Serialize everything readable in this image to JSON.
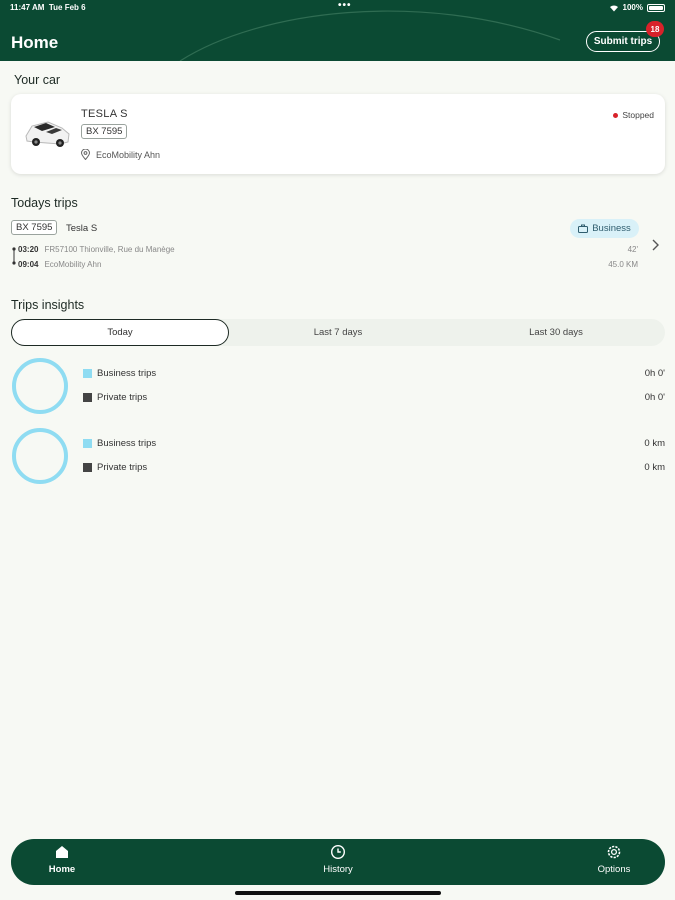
{
  "status_bar": {
    "time": "11:47 AM",
    "date": "Tue Feb 6",
    "battery": "100%"
  },
  "header": {
    "title": "Home",
    "submit_label": "Submit trips",
    "badge_count": "18"
  },
  "your_car": {
    "section_title": "Your car",
    "name": "TESLA S",
    "plate": "BX 7595",
    "location": "EcoMobility Ahn",
    "status": "Stopped",
    "status_color": "#d8222a"
  },
  "todays_trips": {
    "section_title": "Todays trips",
    "trips": [
      {
        "plate": "BX 7595",
        "model": "Tesla S",
        "category": "Business",
        "start_time": "03:20",
        "start_place": "FR57100 Thionville, Rue du Manège",
        "end_time": "09:04",
        "end_place": "EcoMobility Ahn",
        "duration": "42'",
        "distance": "45.0 KM"
      }
    ]
  },
  "insights": {
    "section_title": "Trips insights",
    "tabs": [
      "Today",
      "Last 7 days",
      "Last 30 days"
    ],
    "active_tab": "Today",
    "time_chart": {
      "business_label": "Business trips",
      "business_value": "0h 0'",
      "private_label": "Private trips",
      "private_value": "0h 0'"
    },
    "distance_chart": {
      "business_label": "Business trips",
      "business_value": "0 km",
      "private_label": "Private trips",
      "private_value": "0 km"
    },
    "colors": {
      "business": "#8fdcf2",
      "private": "#444444",
      "ring": "#8fdcf2"
    }
  },
  "bottom_nav": {
    "items": [
      {
        "label": "Home",
        "icon": "home-icon",
        "active": true
      },
      {
        "label": "History",
        "icon": "clock-icon",
        "active": false
      },
      {
        "label": "Options",
        "icon": "gear-icon",
        "active": false
      }
    ]
  },
  "colors": {
    "brand": "#0b4a33",
    "background": "#f7f9f4",
    "badge": "#d8222a"
  }
}
